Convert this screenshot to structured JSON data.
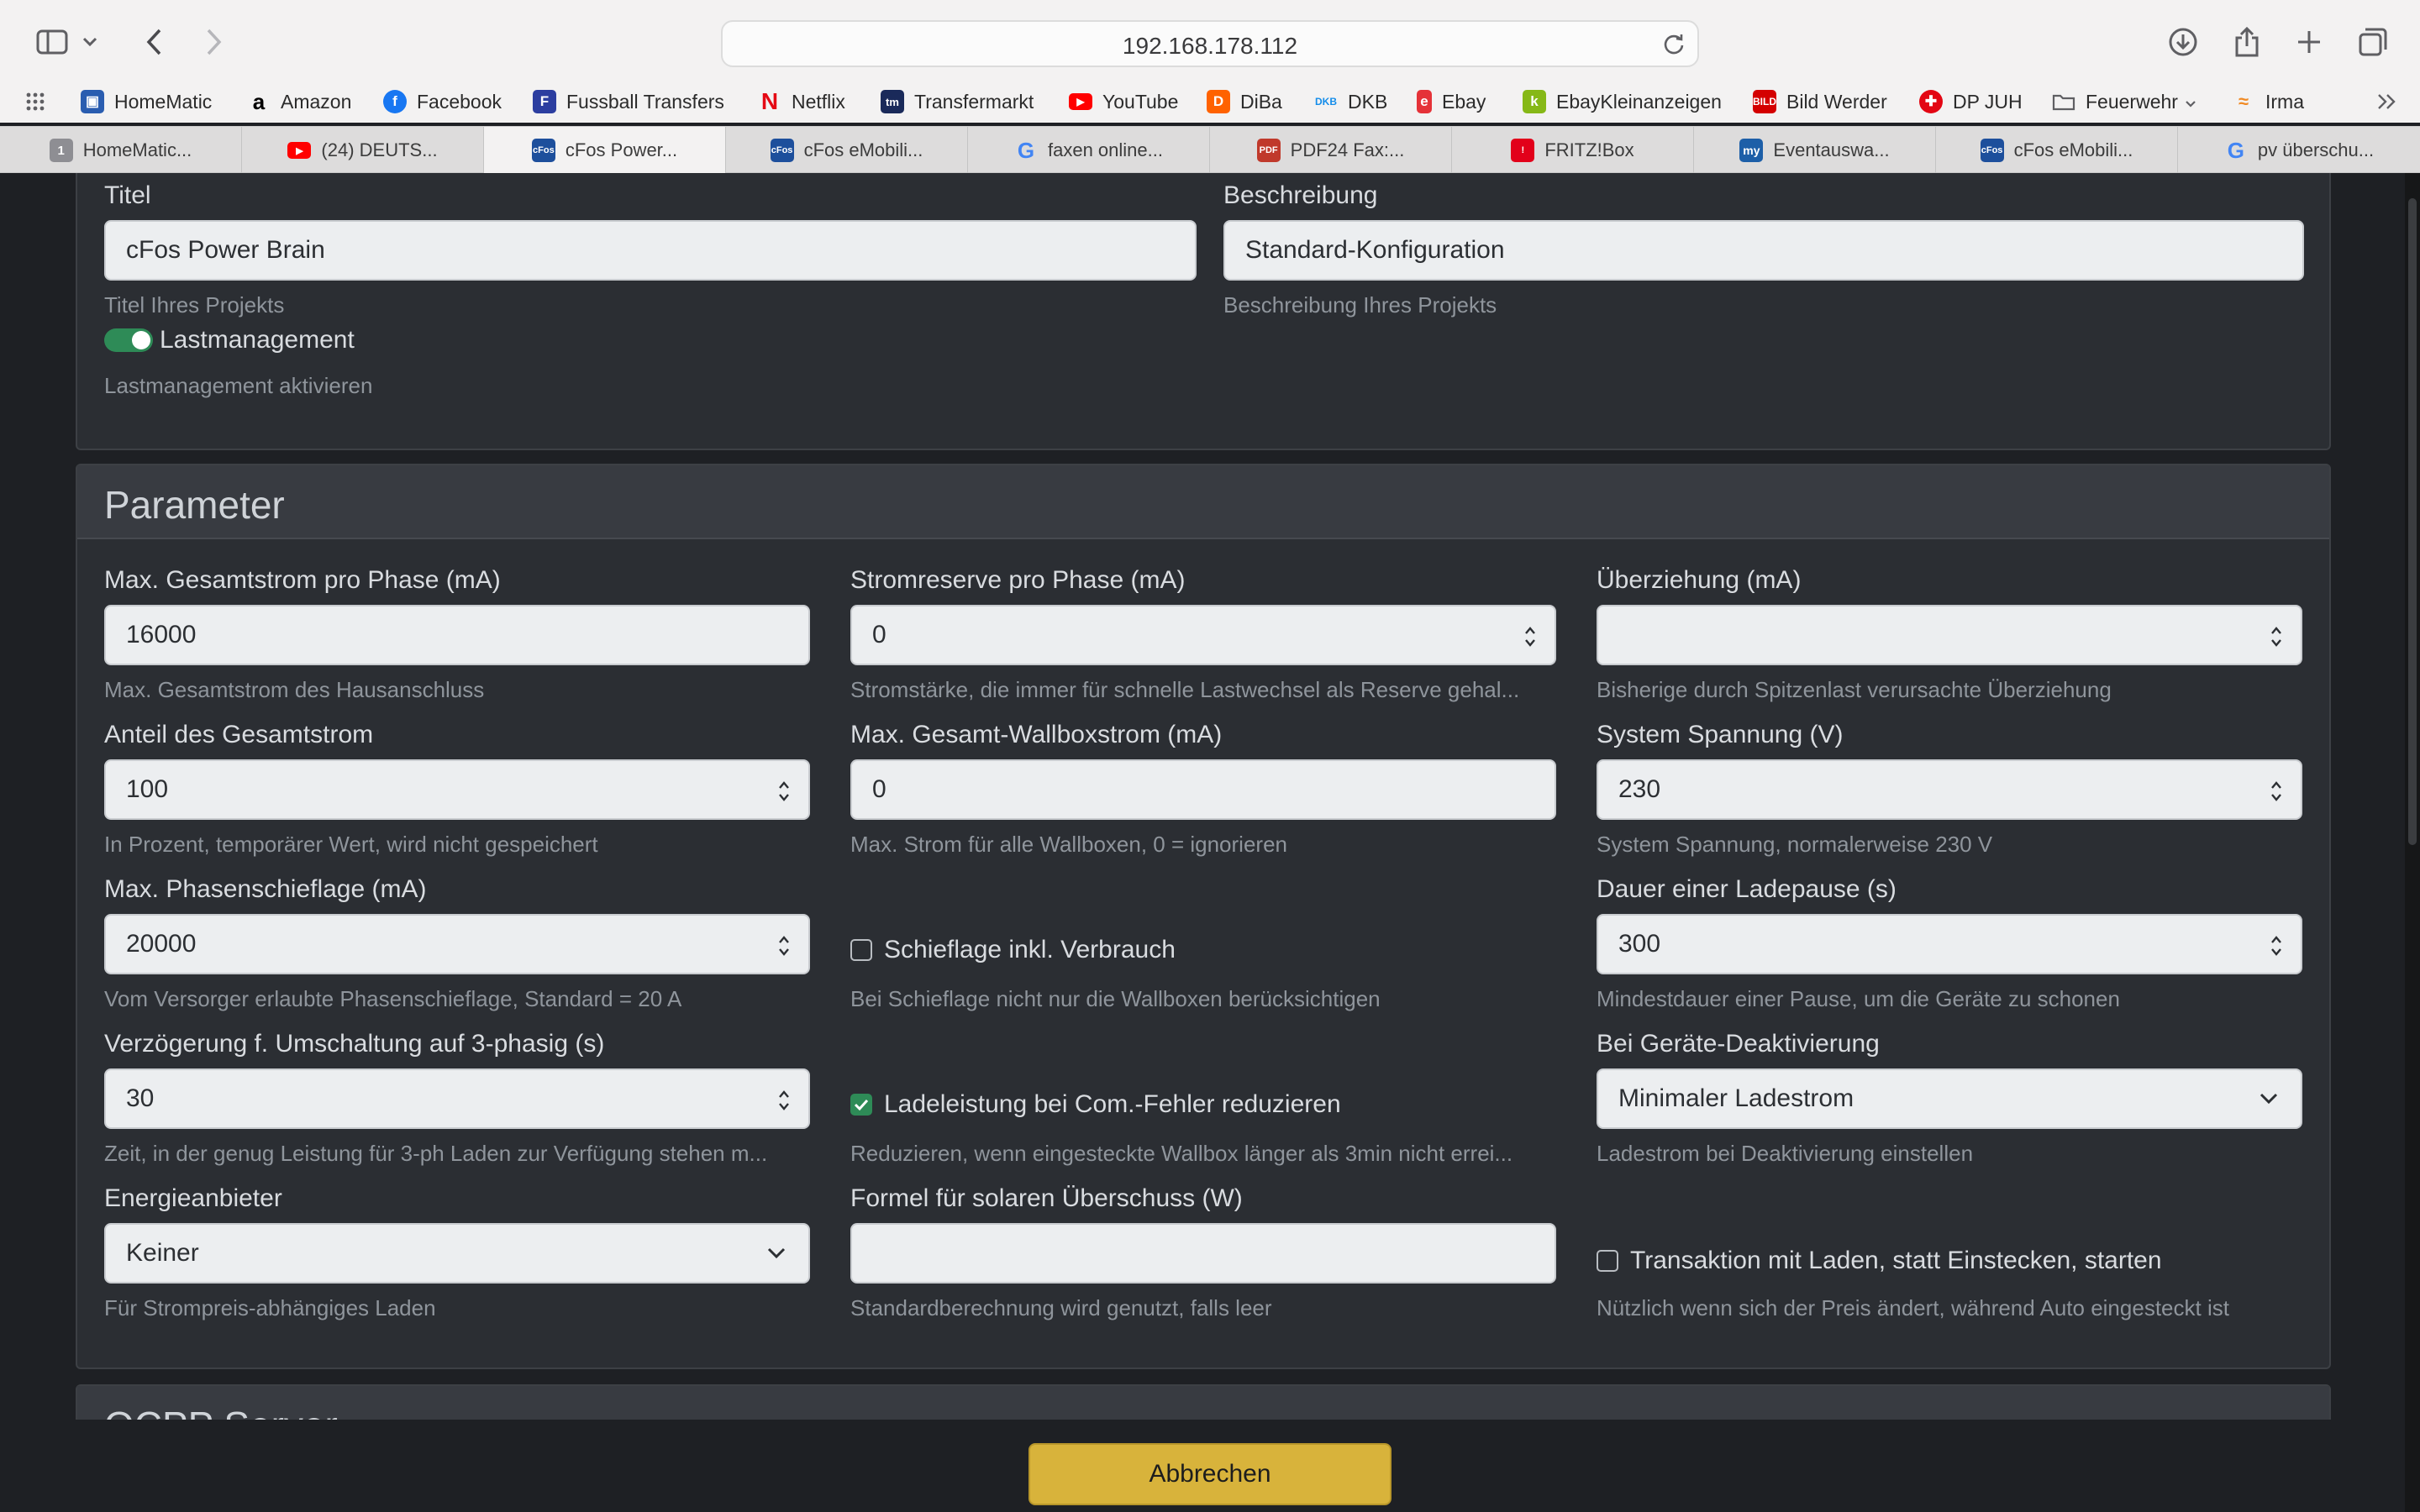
{
  "browser": {
    "url": "192.168.178.112",
    "bookmarks": [
      {
        "label": "HomeMatic",
        "icon": "homematic-icon",
        "color": "#2a5db0"
      },
      {
        "label": "Amazon",
        "icon": "amazon-icon",
        "color": "#000000"
      },
      {
        "label": "Facebook",
        "icon": "facebook-icon",
        "color": "#1877f2"
      },
      {
        "label": "Fussball Transfers",
        "icon": "fussball-transfers-icon",
        "color": "#2c3ea0"
      },
      {
        "label": "Netflix",
        "icon": "netflix-icon",
        "color": "#e50914"
      },
      {
        "label": "Transfermarkt",
        "icon": "transfermarkt-icon",
        "color": "#1a2a5a"
      },
      {
        "label": "YouTube",
        "icon": "youtube-icon",
        "color": "#ff0000"
      },
      {
        "label": "DiBa",
        "icon": "diba-icon",
        "color": "#ff6200"
      },
      {
        "label": "DKB",
        "icon": "dkb-icon",
        "color": "#148dea"
      },
      {
        "label": "Ebay",
        "icon": "ebay-icon",
        "color": "#e53238"
      },
      {
        "label": "EbayKleinanzeigen",
        "icon": "kleinanzeigen-icon",
        "color": "#86b817"
      },
      {
        "label": "Bild Werder",
        "icon": "bild-icon",
        "color": "#d40000"
      },
      {
        "label": "DP JUH",
        "icon": "juh-icon",
        "color": "#e30613"
      },
      {
        "label": "Feuerwehr",
        "icon": "folder-icon",
        "color": "#6e6e73"
      },
      {
        "label": "Irma",
        "icon": "irma-icon",
        "color": "#f08a24"
      }
    ],
    "tabs": [
      {
        "label": "HomeMatic...",
        "icon": "homematic-icon",
        "color": "#8e8e93"
      },
      {
        "label": "(24) DEUTS...",
        "icon": "youtube-icon",
        "color": "#ff0000"
      },
      {
        "label": "cFos Power...",
        "icon": "cfos-icon",
        "color": "#1d4f9c"
      },
      {
        "label": "cFos eMobili...",
        "icon": "cfos-icon",
        "color": "#1d4f9c"
      },
      {
        "label": "faxen online...",
        "icon": "google-icon",
        "color": "#4285f4"
      },
      {
        "label": "PDF24 Fax:...",
        "icon": "pdf24-icon",
        "color": "#c0392b"
      },
      {
        "label": "FRITZ!Box",
        "icon": "fritzbox-icon",
        "color": "#e2001a"
      },
      {
        "label": "Eventauswa...",
        "icon": "myhomematic-icon",
        "color": "#1d5fa8"
      },
      {
        "label": "cFos eMobili...",
        "icon": "cfos-icon",
        "color": "#1d4f9c"
      },
      {
        "label": "pv überschu...",
        "icon": "google-icon",
        "color": "#4285f4"
      }
    ]
  },
  "project": {
    "title_label": "Titel",
    "title_value": "cFos Power Brain",
    "title_help": "Titel Ihres Projekts",
    "desc_label": "Beschreibung",
    "desc_value": "Standard-Konfiguration",
    "desc_help": "Beschreibung Ihres Projekts",
    "load_mgmt_label": "Lastmanagement",
    "load_mgmt_on": true,
    "load_mgmt_help": "Lastmanagement aktivieren"
  },
  "parameter": {
    "heading": "Parameter",
    "max_total_current": {
      "label": "Max. Gesamtstrom pro Phase (mA)",
      "value": "16000",
      "help": "Max. Gesamtstrom des Hausanschluss"
    },
    "current_reserve": {
      "label": "Stromreserve pro Phase (mA)",
      "value": "0",
      "help": "Stromstärke, die immer für schnelle Lastwechsel als Reserve gehal..."
    },
    "overdraw": {
      "label": "Überziehung (mA)",
      "value": "",
      "help": "Bisherige durch Spitzenlast verursachte Überziehung"
    },
    "share_total": {
      "label": "Anteil des Gesamtstrom",
      "value": "100",
      "help": "In Prozent, temporärer Wert, wird nicht gespeichert"
    },
    "max_wallbox_current": {
      "label": "Max. Gesamt-Wallboxstrom (mA)",
      "value": "0",
      "help": "Max. Strom für alle Wallboxen, 0 = ignorieren"
    },
    "system_voltage": {
      "label": "System Spannung (V)",
      "value": "230",
      "help": "System Spannung, normalerweise 230 V"
    },
    "max_phase_imbalance": {
      "label": "Max. Phasenschieflage (mA)",
      "value": "20000",
      "help": "Vom Versorger erlaubte Phasenschieflage, Standard = 20 A"
    },
    "imbalance_incl_consumption": {
      "label": "Schieflage inkl. Verbrauch",
      "checked": false,
      "help": "Bei Schieflage nicht nur die Wallboxen berücksichtigen"
    },
    "charge_pause": {
      "label": "Dauer einer Ladepause (s)",
      "value": "300",
      "help": "Mindestdauer einer Pause, um die Geräte zu schonen"
    },
    "delay_3phase": {
      "label": "Verzögerung f. Umschaltung auf 3-phasig (s)",
      "value": "30",
      "help": "Zeit, in der genug Leistung für 3-ph Laden zur Verfügung stehen m..."
    },
    "reduce_on_com_error": {
      "label": "Ladeleistung bei Com.-Fehler reduzieren",
      "checked": true,
      "help": "Reduzieren, wenn eingesteckte Wallbox länger als 3min nicht errei..."
    },
    "on_device_deactivation": {
      "label": "Bei Geräte-Deaktivierung",
      "value": "Minimaler Ladestrom",
      "help": "Ladestrom bei Deaktivierung einstellen"
    },
    "energy_provider": {
      "label": "Energieanbieter",
      "value": "Keiner",
      "help": "Für Strompreis-abhängiges Laden"
    },
    "solar_formula": {
      "label": "Formel für solaren Überschuss (W)",
      "value": "",
      "help": "Standardberechnung wird genutzt, falls leer"
    },
    "transaction_start": {
      "label": "Transaktion mit Laden, statt Einstecken, starten",
      "checked": false,
      "help": "Nützlich wenn sich der Preis ändert, während Auto eingesteckt ist"
    }
  },
  "next_section": {
    "heading": "OCPP Server"
  },
  "footer": {
    "cancel_label": "Abbrechen"
  },
  "colors": {
    "accent_green": "#2e8b57",
    "cancel_yellow": "#d8b33b",
    "page_bg": "#1e2024",
    "card_bg": "#2b2e33"
  }
}
